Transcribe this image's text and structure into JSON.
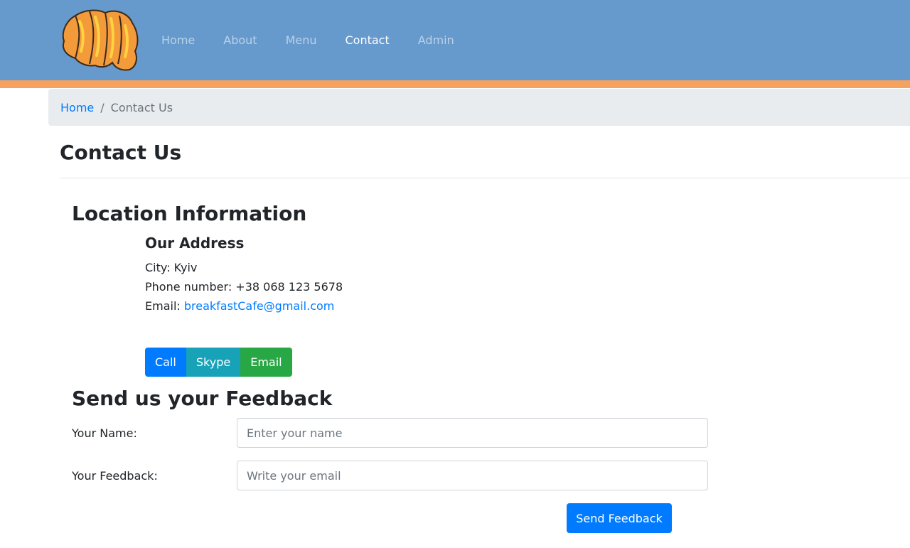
{
  "brand": {
    "logo_icon": "croissant-icon",
    "colors": {
      "header_bg": "#6699cc",
      "header_stripe": "#f6a25e",
      "link": "#007bff"
    }
  },
  "nav": {
    "items": [
      {
        "label": "Home",
        "active": false
      },
      {
        "label": "About",
        "active": false
      },
      {
        "label": "Menu",
        "active": false
      },
      {
        "label": "Contact",
        "active": true
      },
      {
        "label": "Admin",
        "active": false
      }
    ]
  },
  "breadcrumb": {
    "home": "Home",
    "separator": "/",
    "current": "Contact Us"
  },
  "page": {
    "title": "Contact Us"
  },
  "location": {
    "title": "Location Information",
    "address_title": "Our Address",
    "city_label": "City: ",
    "city": "Kyiv",
    "phone_label": "Phone number: ",
    "phone": "+38 068 123 5678",
    "email_label": "Email: ",
    "email": "breakfastCafe@gmail.com"
  },
  "actions": {
    "call": "Call",
    "skype": "Skype",
    "email": "Email"
  },
  "feedback": {
    "title": "Send us your Feedback",
    "name_label": "Your Name:",
    "name_placeholder": "Enter your name",
    "feedback_label": "Your Feedback:",
    "feedback_placeholder": "Write your email",
    "submit": "Send Feedback"
  }
}
